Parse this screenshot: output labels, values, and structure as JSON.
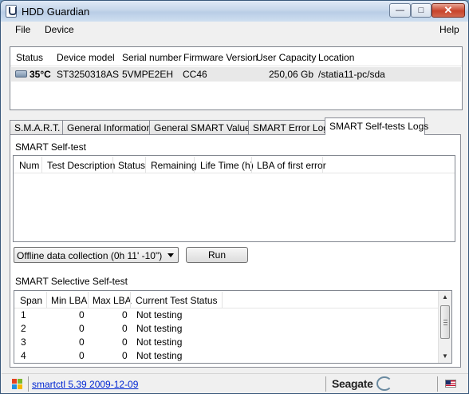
{
  "window": {
    "title": "HDD Guardian"
  },
  "menu": {
    "file": "File",
    "device": "Device",
    "help": "Help"
  },
  "devices": {
    "columns": [
      "Status",
      "Device model",
      "Serial number",
      "Firmware Version",
      "User Capacity",
      "Location"
    ],
    "rows": [
      {
        "status": "35°C",
        "model": "ST3250318AS",
        "serial": "5VMPE2EH",
        "firmware": "CC46",
        "capacity": "250,06 Gb",
        "location": "/statia11-pc/sda"
      }
    ]
  },
  "tabs": [
    "S.M.A.R.T.",
    "General Informations",
    "General SMART Values",
    "SMART Error Log",
    "SMART Self-tests Logs"
  ],
  "active_tab": "SMART Self-tests Logs",
  "self_test": {
    "label": "SMART Self-test",
    "columns": [
      "Num",
      "Test Description",
      "Status",
      "Remaining",
      "Life Time (h)",
      "LBA of first error"
    ],
    "rows": []
  },
  "test_select": {
    "value": "Offline data collection (0h 11' -10\")"
  },
  "run_button": "Run",
  "selective": {
    "label": "SMART Selective Self-test",
    "columns": [
      "Span",
      "Min LBA",
      "Max LBA",
      "Current Test Status"
    ],
    "rows": [
      {
        "span": "1",
        "min": "0",
        "max": "0",
        "status": "Not testing"
      },
      {
        "span": "2",
        "min": "0",
        "max": "0",
        "status": "Not testing"
      },
      {
        "span": "3",
        "min": "0",
        "max": "0",
        "status": "Not testing"
      },
      {
        "span": "4",
        "min": "0",
        "max": "0",
        "status": "Not testing"
      }
    ]
  },
  "statusbar": {
    "link": "smartctl 5.39 2009-12-09",
    "brand": "Seagate"
  },
  "colors": {
    "titlebar": "#c5d6ea",
    "close_button": "#c8432b",
    "link": "#0026d3"
  }
}
